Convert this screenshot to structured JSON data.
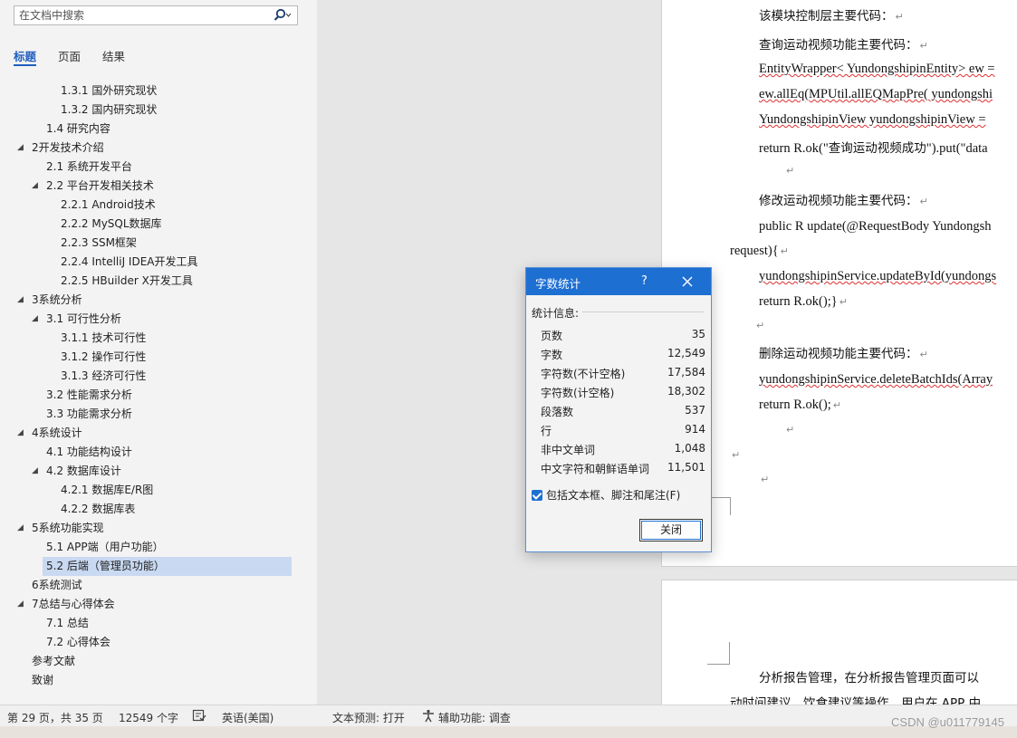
{
  "nav": {
    "search_placeholder": "在文档中搜索",
    "tabs": [
      "标题",
      "页面",
      "结果"
    ],
    "tree": [
      {
        "label": "1.3.1 国外研究现状",
        "level": 3
      },
      {
        "label": "1.3.2 国内研究现状",
        "level": 3
      },
      {
        "label": "1.4 研究内容",
        "level": 2
      },
      {
        "label": "2开发技术介绍",
        "level": 1,
        "expanded": true
      },
      {
        "label": "2.1 系统开发平台",
        "level": 2
      },
      {
        "label": "2.2 平台开发相关技术",
        "level": 2,
        "expanded": true
      },
      {
        "label": "2.2.1 Android技术",
        "level": 3
      },
      {
        "label": "2.2.2 MySQL数据库",
        "level": 3
      },
      {
        "label": "2.2.3 SSM框架",
        "level": 3
      },
      {
        "label": "2.2.4 IntelliJ IDEA开发工具",
        "level": 3
      },
      {
        "label": "2.2.5 HBuilder X开发工具",
        "level": 3
      },
      {
        "label": "3系统分析",
        "level": 1,
        "expanded": true
      },
      {
        "label": "3.1 可行性分析",
        "level": 2,
        "expanded": true
      },
      {
        "label": "3.1.1 技术可行性",
        "level": 3
      },
      {
        "label": "3.1.2 操作可行性",
        "level": 3
      },
      {
        "label": "3.1.3 经济可行性",
        "level": 3
      },
      {
        "label": "3.2 性能需求分析",
        "level": 2
      },
      {
        "label": "3.3 功能需求分析",
        "level": 2
      },
      {
        "label": "4系统设计",
        "level": 1,
        "expanded": true
      },
      {
        "label": "4.1 功能结构设计",
        "level": 2
      },
      {
        "label": "4.2 数据库设计",
        "level": 2,
        "expanded": true
      },
      {
        "label": "4.2.1 数据库E/R图",
        "level": 3
      },
      {
        "label": "4.2.2 数据库表",
        "level": 3
      },
      {
        "label": "5系统功能实现",
        "level": 1,
        "expanded": true
      },
      {
        "label": "5.1 APP端（用户功能）",
        "level": 2
      },
      {
        "label": "5.2 后端（管理员功能）",
        "level": 2,
        "selected": true
      },
      {
        "label": "6系统测试",
        "level": 1
      },
      {
        "label": "7总结与心得体会",
        "level": 1,
        "expanded": true
      },
      {
        "label": "7.1 总结",
        "level": 2
      },
      {
        "label": "7.2 心得体会",
        "level": 2
      },
      {
        "label": "参考文献",
        "level": 1
      },
      {
        "label": "致谢",
        "level": 1
      }
    ]
  },
  "document": {
    "line1": "该模块控制层主要代码：",
    "line2": "查询运动视频功能主要代码：",
    "line3": "EntityWrapper< YundongshipinEntity> ew =",
    "line4": "ew.allEq(MPUtil.allEQMapPre( yundongshi",
    "line5": "YundongshipinView yundongshipinView =",
    "line6a": "return R.ok(\"",
    "line6b": "查询运动视频成功",
    "line6c": "\").put(\"data",
    "line7": "修改运动视频功能主要代码：",
    "line8": "public R update(@RequestBody Yundongsh",
    "line9": "request){",
    "line10": "yundongshipinService.updateById(yundongs",
    "line11": "return R.ok();}",
    "line12": "删除运动视频功能主要代码：",
    "line13": "yundongshipinService.deleteBatchIds(Array",
    "line14": "return R.ok();",
    "page2_line1": "分析报告管理，在分析报告管理页面可以",
    "page2_line2": "动时间建议、饮食建议等操作。用户在 APP 中",
    "para_mark": "↵"
  },
  "dialog": {
    "title": "字数统计",
    "help": "?",
    "section": "统计信息:",
    "stats": [
      {
        "label": "页数",
        "value": "35"
      },
      {
        "label": "字数",
        "value": "12,549"
      },
      {
        "label": "字符数(不计空格)",
        "value": "17,584"
      },
      {
        "label": "字符数(计空格)",
        "value": "18,302"
      },
      {
        "label": "段落数",
        "value": "537"
      },
      {
        "label": "行",
        "value": "914"
      },
      {
        "label": "非中文单词",
        "value": "1,048"
      },
      {
        "label": "中文字符和朝鲜语单词",
        "value": "11,501"
      }
    ],
    "checkbox_label": "包括文本框、脚注和尾注(F)",
    "checkbox_checked": true,
    "close_button": "关闭"
  },
  "status": {
    "page": "第 29 页，共 35 页",
    "words": "12549 个字",
    "language": "英语(美国)",
    "predict": "文本预测: 打开",
    "accessibility": "辅助功能: 调查"
  },
  "watermark": "CSDN @u011779145",
  "accent_color": "#1e6fd2"
}
